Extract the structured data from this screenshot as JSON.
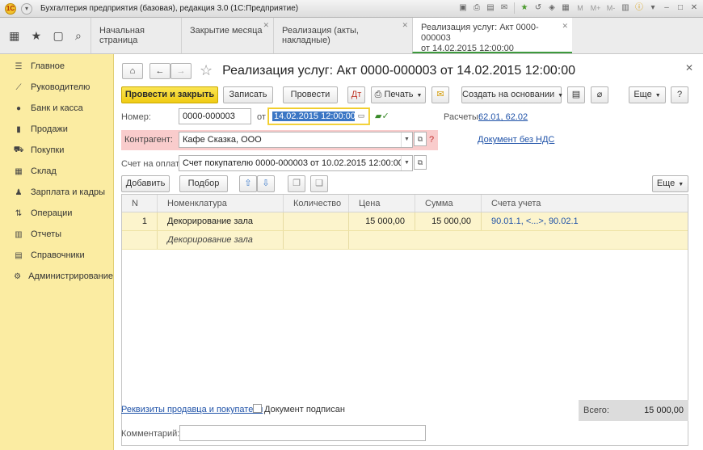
{
  "window": {
    "title": "Бухгалтерия предприятия (базовая), редакция 3.0  (1С:Предприятие)",
    "buttons": [
      "M",
      "M+",
      "M-"
    ]
  },
  "tabs": [
    {
      "label": "Начальная страница"
    },
    {
      "label": "Закрытие месяца"
    },
    {
      "label": "Реализация (акты, накладные)"
    },
    {
      "label_line1": "Реализация услуг: Акт 0000-000003",
      "label_line2": "от 14.02.2015 12:00:00"
    }
  ],
  "sidebar": {
    "items": [
      {
        "label": "Главное",
        "icon": "menu-icon"
      },
      {
        "label": "Руководителю",
        "icon": "chart-line-icon"
      },
      {
        "label": "Банк и касса",
        "icon": "coin-icon"
      },
      {
        "label": "Продажи",
        "icon": "bag-icon"
      },
      {
        "label": "Покупки",
        "icon": "cart-icon"
      },
      {
        "label": "Склад",
        "icon": "warehouse-icon"
      },
      {
        "label": "Зарплата и кадры",
        "icon": "person-icon"
      },
      {
        "label": "Операции",
        "icon": "operations-icon"
      },
      {
        "label": "Отчеты",
        "icon": "bar-chart-icon"
      },
      {
        "label": "Справочники",
        "icon": "book-icon"
      },
      {
        "label": "Администрирование",
        "icon": "gear-icon"
      }
    ]
  },
  "document": {
    "title": "Реализация услуг: Акт 0000-000003 от 14.02.2015 12:00:00"
  },
  "toolbar": {
    "post_close": "Провести и закрыть",
    "save": "Записать",
    "post": "Провести",
    "print": "Печать",
    "create_based": "Создать на основании",
    "more": "Еще",
    "help": "?"
  },
  "form": {
    "number_label": "Номер:",
    "number_value": "0000-000003",
    "date_label": "от",
    "date_value": "14.02.2015 12:00:00",
    "accounts_label": "Расчеты:",
    "accounts_link": "62.01, 62.02",
    "counterparty_label": "Контрагент:",
    "counterparty_value": "Кафе Сказка, ООО",
    "vat_link": "Документ без НДС",
    "invoice_label": "Счет на оплату:",
    "invoice_value": "Счет покупателю 0000-000003 от 10.02.2015 12:00:00"
  },
  "table_toolbar": {
    "add": "Добавить",
    "pick": "Подбор",
    "more": "Еще"
  },
  "table": {
    "columns": [
      "N",
      "Номенклатура",
      "Количество",
      "Цена",
      "Сумма",
      "Счета учета"
    ],
    "rows": [
      {
        "n": "1",
        "item": "Декорирование зала",
        "item_sub": "Декорирование зала",
        "qty": "",
        "price": "15 000,00",
        "sum": "15 000,00",
        "accounts": "90.01.1, <...>, 90.02.1"
      }
    ]
  },
  "footer": {
    "requisites_link": "Реквизиты продавца и покупателя",
    "signed_label": "Документ подписан",
    "total_label": "Всего:",
    "total_value": "15 000,00",
    "comment_label": "Комментарий:",
    "comment_value": ""
  }
}
